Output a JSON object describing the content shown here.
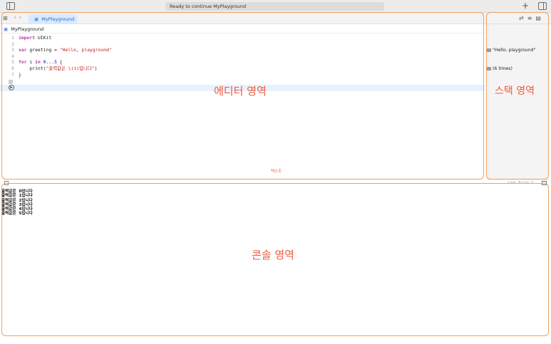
{
  "titlebar": {
    "status": "Ready to continue MyPlayground",
    "add_label": "+"
  },
  "tabbar": {
    "tab_label": "MyPlayground"
  },
  "breadcrumb": {
    "label": "MyPlayground"
  },
  "editor": {
    "lines": [
      {
        "num": "1",
        "parts": [
          {
            "t": "import",
            "c": "kw"
          },
          {
            "t": " UIKit",
            "c": ""
          }
        ]
      },
      {
        "num": "2",
        "parts": []
      },
      {
        "num": "3",
        "parts": [
          {
            "t": "var",
            "c": "kw"
          },
          {
            "t": " greeting = ",
            "c": ""
          },
          {
            "t": "\"Hello, playground\"",
            "c": "str"
          }
        ]
      },
      {
        "num": "4",
        "parts": []
      },
      {
        "num": "5",
        "parts": [
          {
            "t": "for",
            "c": "kw"
          },
          {
            "t": " i ",
            "c": ""
          },
          {
            "t": "in",
            "c": "kw"
          },
          {
            "t": " ",
            "c": ""
          },
          {
            "t": "0",
            "c": "num"
          },
          {
            "t": "...",
            "c": ""
          },
          {
            "t": "5",
            "c": "num"
          },
          {
            "t": " {",
            "c": ""
          }
        ]
      },
      {
        "num": "6",
        "parts": [
          {
            "t": "    print(",
            "c": ""
          },
          {
            "t": "\"출력값은 \\(i)입니다\"",
            "c": "str"
          },
          {
            "t": ")",
            "c": ""
          }
        ]
      },
      {
        "num": "7",
        "parts": [
          {
            "t": "}",
            "c": ""
          }
        ]
      }
    ]
  },
  "results": {
    "greeting": "\"Hello, playground\"",
    "loop": "(6 times)"
  },
  "annotations": {
    "editor": "에디터 영역",
    "stack": "스택 영역",
    "console": "콘솔 영역",
    "text_small": "텍스트"
  },
  "statusbar": {
    "cursor": "Line: 8  Col: 1"
  },
  "console": {
    "lines": [
      "출력값은  0입니다",
      "출력값은  1입니다",
      "출력값은  2입니다",
      "출력값은  3입니다",
      "출력값은  4입니다",
      "출력값은  5입니다"
    ]
  },
  "colors": {
    "annotation": "#ef5a3c",
    "region_border": "#f0a060",
    "tab_accent": "#1a6dd6"
  }
}
